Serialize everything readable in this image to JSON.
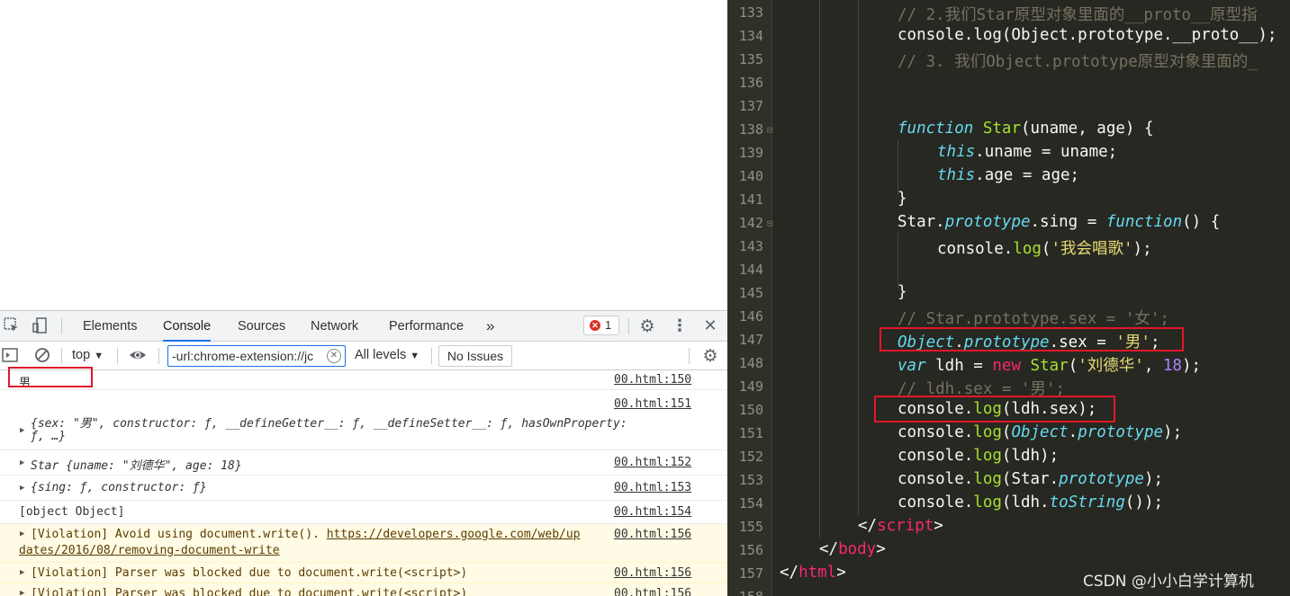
{
  "devtools": {
    "tabs": [
      "Elements",
      "Console",
      "Sources",
      "Network",
      "Performance"
    ],
    "more_tabs": "»",
    "error_count": "1",
    "filter": {
      "context": "top",
      "filter_value": "-url:chrome-extension://jc",
      "levels": "All levels",
      "issues": "No Issues"
    },
    "messages": [
      {
        "text": "男",
        "source": "00.html:150"
      },
      {
        "text": "{sex: \"男\", constructor: ƒ, __defineGetter__: ƒ, __defineSetter__: ƒ, hasOwnProperty:",
        "text2": "ƒ, …}",
        "source": "00.html:151"
      },
      {
        "text": "Star {uname: \"刘德华\", age: 18}",
        "source": "00.html:152"
      },
      {
        "text": "{sing: ƒ, constructor: ƒ}",
        "source": "00.html:153"
      },
      {
        "text": "[object Object]",
        "source": "00.html:154"
      },
      {
        "text": "[Violation] Avoid using document.write(). ",
        "link": "https://developers.google.com/web/up",
        "text2": "dates/2016/08/removing-document-write",
        "source": "00.html:156"
      },
      {
        "text": "[Violation] Parser was blocked due to document.write(<script>)",
        "source": "00.html:156"
      },
      {
        "text": "[Violation] Parser was blocked due to document.write(<script>)",
        "source": "00.html:156"
      }
    ]
  },
  "editor": {
    "line_numbers": [
      "133",
      "134",
      "135",
      "136",
      "137",
      "138",
      "139",
      "140",
      "141",
      "142",
      "143",
      "144",
      "145",
      "146",
      "147",
      "148",
      "149",
      "150",
      "151",
      "152",
      "153",
      "154",
      "155",
      "156",
      "157",
      "158"
    ],
    "lines": {
      "l133": "// 2.我们Star原型对象里面的__proto__原型指",
      "l134a": "console.log(Object.prototype.",
      "l134b": "__proto__",
      "l134c": ");",
      "l135": "// 3. 我们Object.prototype原型对象里面的_",
      "l138_kw": "function",
      "l138_fn": "Star",
      "l138_rest": "(uname, age) {",
      "this": "this",
      "l139_rest": ".uname = uname;",
      "l140_rest": ".age = age;",
      "l141": "}",
      "l142_a": "Star.",
      "l142_b": "prototype",
      "l142_c": ".sing = ",
      "l142_d": "function",
      "l142_e": "() {",
      "l143_a": "console.",
      "l143_b": "log",
      "l143_c": "(",
      "l143_d": "'我会唱歌'",
      "l143_e": ");",
      "l145": "}",
      "l146": "// Star.prototype.sex = '女';",
      "l147_a": "Object",
      "l147_b": ".",
      "l147_c": "prototype",
      "l147_d": ".sex = ",
      "l147_e": "'男'",
      "l147_f": ";",
      "l148_a": "var",
      "l148_b": " ldh = ",
      "l148_c": "new",
      "l148_d": " ",
      "l148_e": "Star",
      "l148_f": "(",
      "l148_g": "'刘德华'",
      "l148_h": ", ",
      "l148_i": "18",
      "l148_j": ");",
      "l149": "// ldh.sex = '男';",
      "l150_a": "console.",
      "l150_b": "log",
      "l150_c": "(ldh.sex);",
      "l151_c1": "(",
      "l151_d": "Object",
      "l151_e": ".",
      "l151_f": "prototype",
      "l151_g": ");",
      "l152_c": "(ldh);",
      "l153_c": "(Star.",
      "l153_d": "prototype",
      "l153_e": ");",
      "l154_c": "(ldh.",
      "l154_d": "toString",
      "l154_e": "());",
      "l155_a": "</",
      "l155_b": "script",
      "l155_c": ">",
      "l156_b": "body",
      "l157_b": "html"
    }
  },
  "watermark": "CSDN @小小白学计算机",
  "colors": {
    "accent": "#1a73e8",
    "error": "#d93025",
    "highlight_box": "#e3172a",
    "editor_bg": "#272822"
  }
}
